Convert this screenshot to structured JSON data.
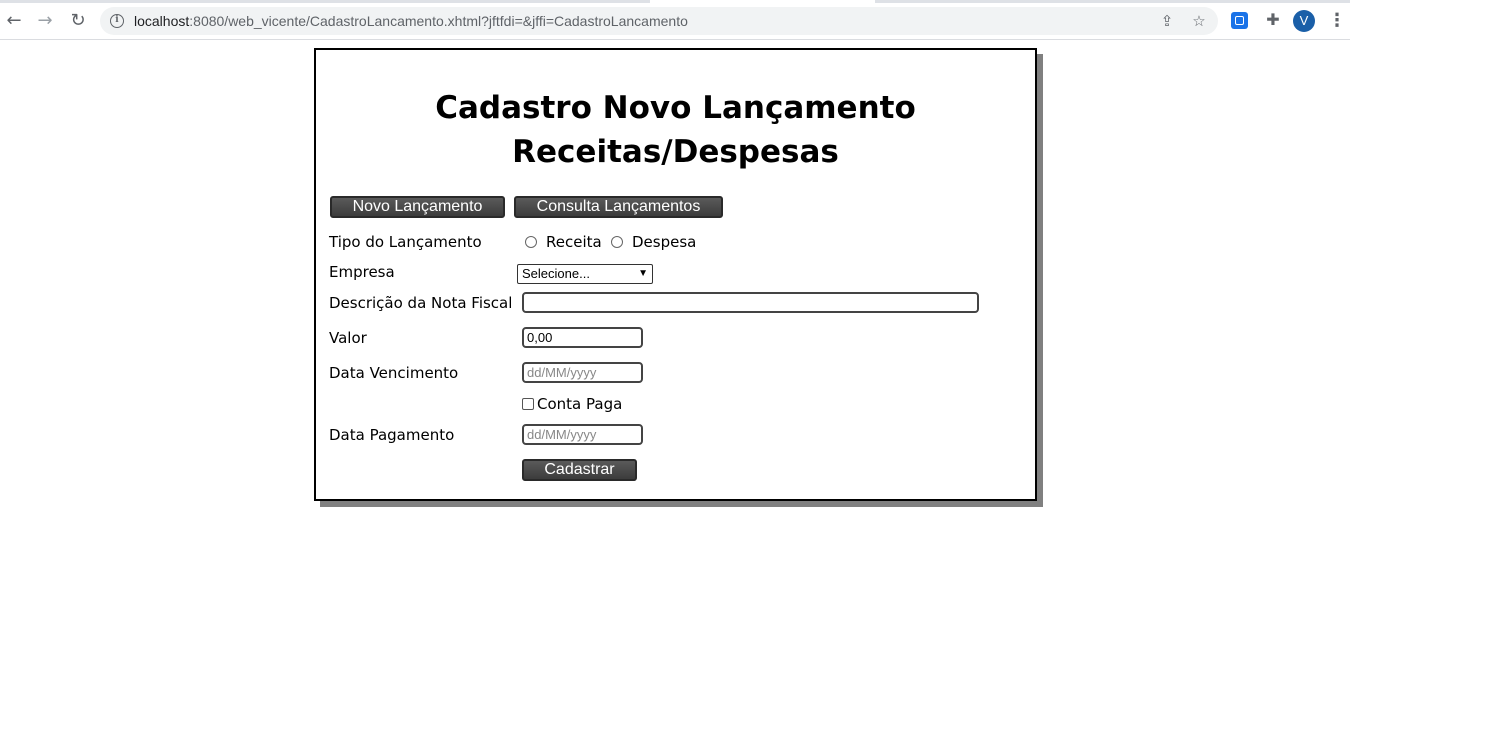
{
  "browser": {
    "url_host": "localhost",
    "url_rest": ":8080/web_vicente/CadastroLancamento.xhtml?jftfdi=&jffi=CadastroLancamento",
    "profile_initial": "V"
  },
  "form": {
    "title_line1": "Cadastro Novo Lançamento",
    "title_line2": "Receitas/Despesas",
    "buttons": {
      "new_label": "Novo Lançamento",
      "search_label": "Consulta Lançamentos",
      "submit_label": "Cadastrar"
    },
    "fields": {
      "tipo_label": "Tipo do Lançamento",
      "tipo_options": [
        "Receita",
        "Despesa"
      ],
      "empresa_label": "Empresa",
      "empresa_selected": "Selecione...",
      "descricao_label": "Descrição da Nota Fiscal",
      "descricao_value": "",
      "valor_label": "Valor",
      "valor_value": "0,00",
      "vencimento_label": "Data Vencimento",
      "vencimento_placeholder": "dd/MM/yyyy",
      "conta_paga_label": "Conta Paga",
      "pagamento_label": "Data Pagamento",
      "pagamento_placeholder": "dd/MM/yyyy"
    }
  }
}
